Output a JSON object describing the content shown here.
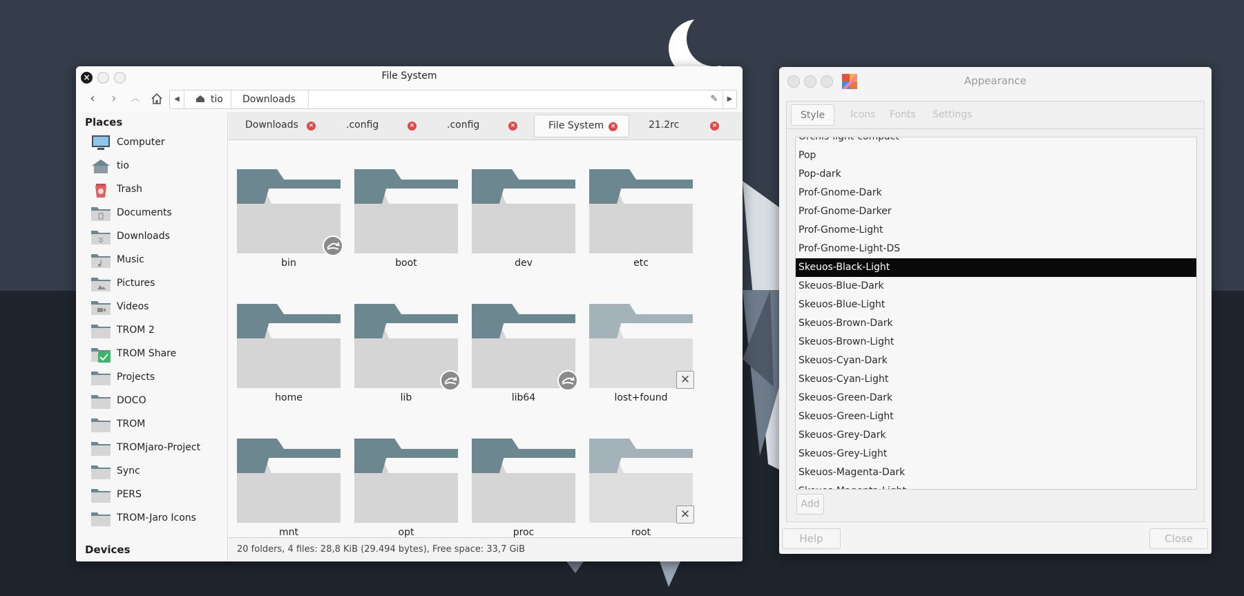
{
  "file_manager": {
    "title": "File System",
    "path_segments": [
      "tio",
      "Downloads"
    ],
    "sidebar": {
      "places_heading": "Places",
      "devices_heading": "Devices",
      "items": [
        {
          "label": "Computer",
          "icon": "computer-icon"
        },
        {
          "label": "tio",
          "icon": "home-icon"
        },
        {
          "label": "Trash",
          "icon": "trash-icon"
        },
        {
          "label": "Documents",
          "icon": "folder-documents-icon"
        },
        {
          "label": "Downloads",
          "icon": "folder-downloads-icon"
        },
        {
          "label": "Music",
          "icon": "folder-music-icon"
        },
        {
          "label": "Pictures",
          "icon": "folder-pictures-icon"
        },
        {
          "label": "Videos",
          "icon": "folder-videos-icon"
        },
        {
          "label": "TROM 2",
          "icon": "folder-icon"
        },
        {
          "label": "TROM Share",
          "icon": "folder-sync-check-icon"
        },
        {
          "label": "Projects",
          "icon": "folder-icon"
        },
        {
          "label": "DOCO",
          "icon": "folder-icon"
        },
        {
          "label": "TROM",
          "icon": "folder-icon"
        },
        {
          "label": "TROMjaro-Project",
          "icon": "folder-icon"
        },
        {
          "label": "Sync",
          "icon": "folder-icon"
        },
        {
          "label": "PERS",
          "icon": "folder-icon"
        },
        {
          "label": "TROM-Jaro Icons",
          "icon": "folder-icon"
        }
      ]
    },
    "tabs": [
      {
        "label": "Downloads",
        "active": false
      },
      {
        "label": ".config",
        "active": false
      },
      {
        "label": ".config",
        "active": false
      },
      {
        "label": "File System",
        "active": true
      },
      {
        "label": "21.2rc",
        "active": false
      }
    ],
    "folders": [
      {
        "name": "bin",
        "emblem": "symlink"
      },
      {
        "name": "boot",
        "emblem": ""
      },
      {
        "name": "dev",
        "emblem": ""
      },
      {
        "name": "etc",
        "emblem": ""
      },
      {
        "name": "home",
        "emblem": ""
      },
      {
        "name": "lib",
        "emblem": "symlink"
      },
      {
        "name": "lib64",
        "emblem": "symlink"
      },
      {
        "name": "lost+found",
        "emblem": "unreadable"
      },
      {
        "name": "mnt",
        "emblem": ""
      },
      {
        "name": "opt",
        "emblem": ""
      },
      {
        "name": "proc",
        "emblem": ""
      },
      {
        "name": "root",
        "emblem": "unreadable"
      }
    ],
    "status": "20 folders, 4 files: 28,8 KiB (29.494 bytes), Free space: 33,7 GiB"
  },
  "appearance": {
    "title": "Appearance",
    "tabs": [
      "Style",
      "Icons",
      "Fonts",
      "Settings"
    ],
    "active_tab": "Style",
    "themes": [
      "Orchis-light-compact",
      "Pop",
      "Pop-dark",
      "Prof-Gnome-Dark",
      "Prof-Gnome-Darker",
      "Prof-Gnome-Light",
      "Prof-Gnome-Light-DS",
      "Skeuos-Black-Light",
      "Skeuos-Blue-Dark",
      "Skeuos-Blue-Light",
      "Skeuos-Brown-Dark",
      "Skeuos-Brown-Light",
      "Skeuos-Cyan-Dark",
      "Skeuos-Cyan-Light",
      "Skeuos-Green-Dark",
      "Skeuos-Green-Light",
      "Skeuos-Grey-Dark",
      "Skeuos-Grey-Light",
      "Skeuos-Magenta-Dark",
      "Skeuos-Magenta-Light"
    ],
    "selected_theme": "Skeuos-Black-Light",
    "add_label": "Add",
    "help_label": "Help",
    "close_label": "Close"
  },
  "colors": {
    "folder_dark": "#6d8790",
    "folder_body": "#d5d5d5",
    "selection": "#0a0a0a",
    "tab_close": "#e04848"
  }
}
